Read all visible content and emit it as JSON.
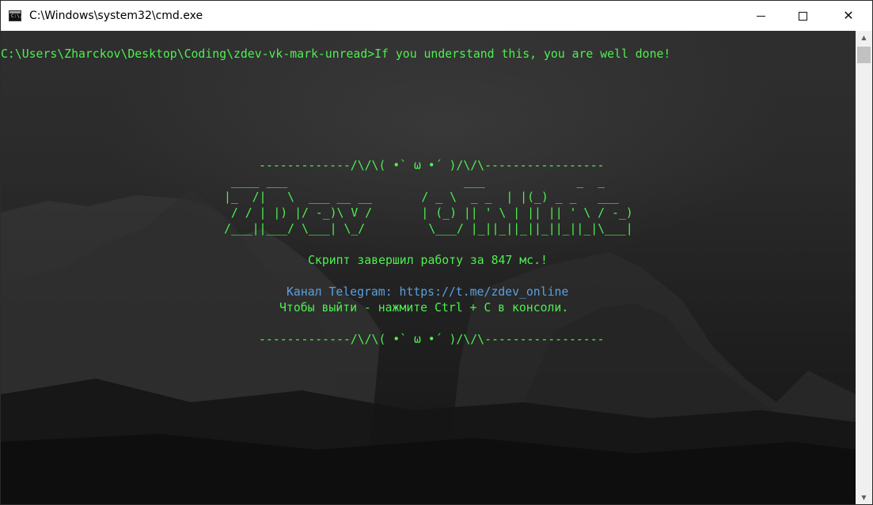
{
  "window": {
    "title": "C:\\Windows\\system32\\cmd.exe",
    "icon_text": "C:\\.",
    "controls": {
      "minimize": "minimize-icon",
      "maximize": "maximize-icon",
      "close": "✕"
    }
  },
  "console": {
    "prompt_line": "C:\\Users\\Zharckov\\Desktop\\Coding\\zdev-vk-mark-unread>If you understand this, you are well done!",
    "separator_top": "-------------/\\/\\( •` ω •´ )/\\/\\-----------------",
    "ascii_art": [
      " ____ ___                         ___             _  _",
      "|_  /|   \\  ___ __ __       / _ \\  _ _  | |(_) _ _   ___",
      " / / | |) |/ -_)\\ V /       | (_) || ' \\ | || || ' \\ / -_)",
      "/___||___/ \\___| \\_/         \\___/ |_||_||_||_||_||_|\\___|"
    ],
    "status_line": "Скрипт завершил работу за 847 мс.!",
    "telegram_line": "Канал Telegram: https://t.me/zdev_online",
    "exit_line": "Чтобы выйти - нажмите Ctrl + C в консоли.",
    "separator_bottom": "-------------/\\/\\( •` ω •´ )/\\/\\-----------------"
  },
  "colors": {
    "text_green": "#4ef050",
    "text_blue": "#5aa0e0",
    "titlebar": "#ffffff"
  },
  "scrollbar": {
    "up": "▲",
    "down": "▼"
  }
}
